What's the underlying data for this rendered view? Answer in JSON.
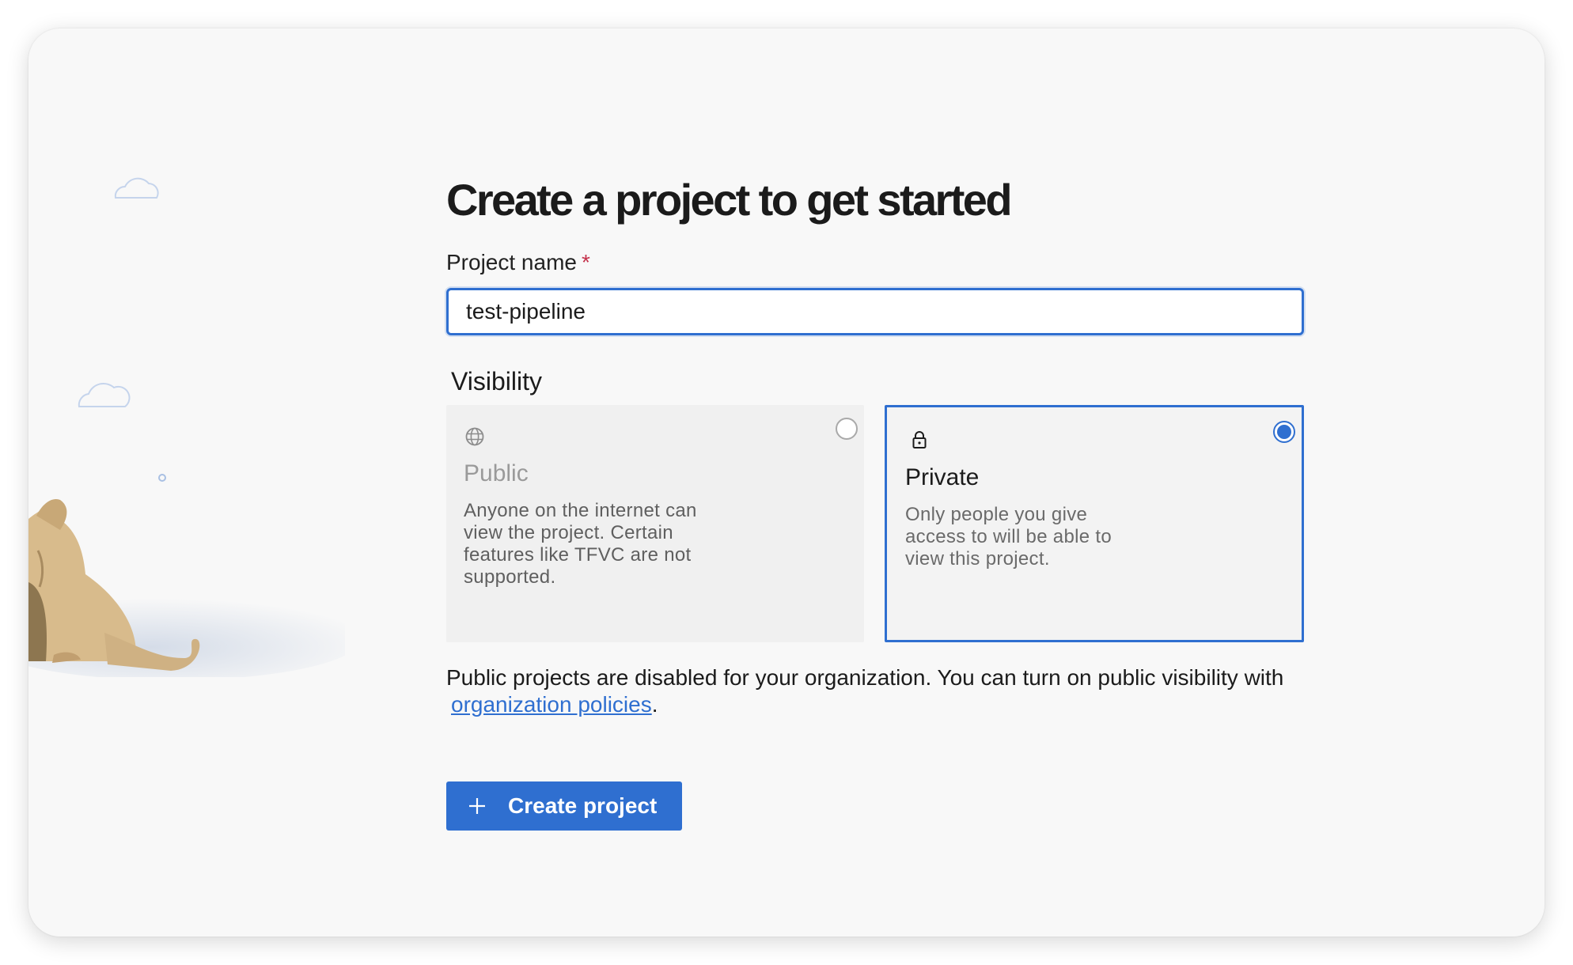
{
  "page": {
    "title": "Create a project to get started"
  },
  "form": {
    "name_label": "Project name",
    "required_marker": "*",
    "name_value": "test-pipeline",
    "visibility_heading": "Visibility"
  },
  "visibility_options": [
    {
      "title": "Public",
      "description": "Anyone on the internet can view the project. Certain features like TFVC are not supported.",
      "icon": "globe-icon",
      "selected": false,
      "disabled": true
    },
    {
      "title": "Private",
      "description": "Only people you give access to will be able to view this project.",
      "icon": "lock-icon",
      "selected": true,
      "disabled": false
    }
  ],
  "notice": {
    "text": "Public projects are disabled for your organization. You can turn on public visibility with",
    "link_text": "organization policies",
    "trailing": "."
  },
  "actions": {
    "create_label": "Create project",
    "create_icon": "plus-icon"
  },
  "colors": {
    "accent": "#2f6fd0",
    "required": "#c4314b",
    "background": "#f8f8f8"
  }
}
